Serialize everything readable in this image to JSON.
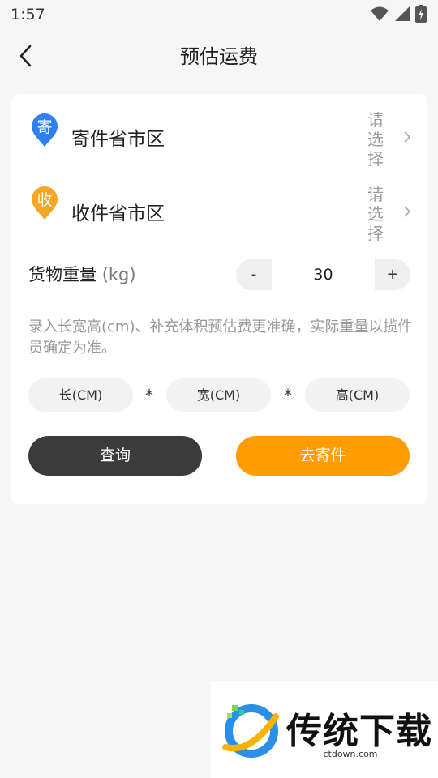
{
  "status_bar": {
    "time": "1:57"
  },
  "header": {
    "title": "预估运费"
  },
  "sender": {
    "badge": "寄",
    "label": "寄件省市区",
    "action": "请选择"
  },
  "receiver": {
    "badge": "收",
    "label": "收件省市区",
    "action": "请选择"
  },
  "weight": {
    "label": "货物重量",
    "unit": "(kg)",
    "minus": "-",
    "plus": "+",
    "value": "30"
  },
  "hint": "录入长宽高(cm)、补充体积预估费更准确，实际重量以揽件员确定为准。",
  "dimensions": {
    "length_placeholder": "长(CM)",
    "width_placeholder": "宽(CM)",
    "height_placeholder": "高(CM)",
    "separator": "*"
  },
  "buttons": {
    "query": "查询",
    "send": "去寄件"
  },
  "watermark": {
    "brand": "传统下载",
    "url": "ctdown.com"
  },
  "colors": {
    "accent": "#ff9c00",
    "sender_pin": "#2f7ff0",
    "receiver_pin": "#f5a623",
    "dark_button": "#3b3b3b"
  }
}
